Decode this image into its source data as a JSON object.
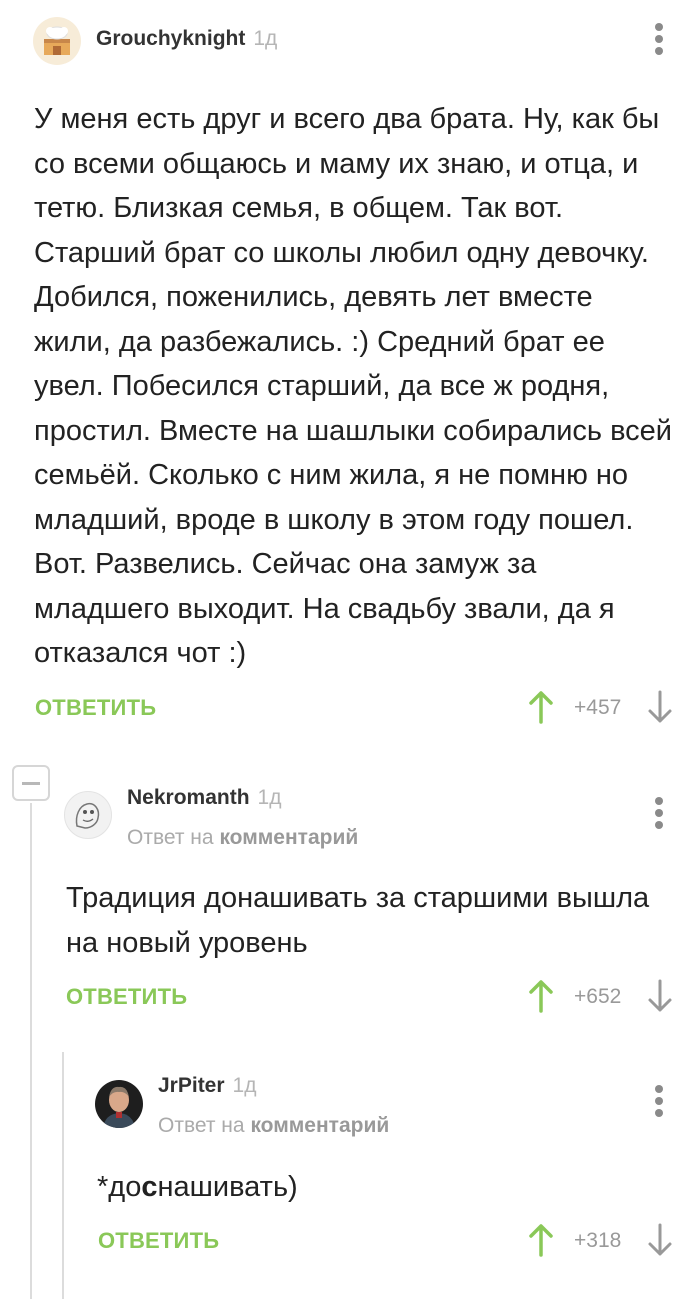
{
  "comment1": {
    "author": "Grouchyknight",
    "time": "1д",
    "text": "У меня есть друг и всего два брата. Ну, как бы со всеми общаюсь и маму их знаю, и отца, и тетю. Близкая семья, в общем. Так вот. Старший брат со школы любил одну девочку. Добился, поженились, девять лет вместе жили, да разбежались. :) Средний брат ее увел. Побесился старший, да все ж родня, простил. Вместе на шашлыки собирались всей семьёй. Сколько с ним жила, я не помню но младший, вроде в школу в этом году пошел. Вот. Развелись. Сейчас она замуж за младшего выходит. На свадьбу звали, да я отказался чот :)",
    "reply_label": "ОТВЕТИТЬ",
    "score": "+457"
  },
  "comment2": {
    "author": "Nekromanth",
    "time": "1д",
    "reply_prefix": "Ответ на",
    "reply_target": "комментарий",
    "text": "Традиция донашивать за старшими вышла на новый уровень",
    "reply_label": "ОТВЕТИТЬ",
    "score": "+652"
  },
  "comment3": {
    "author": "JrPiter",
    "time": "1д",
    "reply_prefix": "Ответ на",
    "reply_target": "комментарий",
    "text_prefix": "*до",
    "text_bold": "с",
    "text_suffix": "нашивать)",
    "reply_label": "ОТВЕТИТЬ",
    "score": "+318"
  },
  "colors": {
    "accent_green": "#8ac858",
    "muted_gray": "#999999",
    "thread_line": "#dcdcdc"
  },
  "icons": [
    "kebab-menu-icon",
    "upvote-arrow-icon",
    "downvote-arrow-icon",
    "collapse-thread-icon"
  ]
}
